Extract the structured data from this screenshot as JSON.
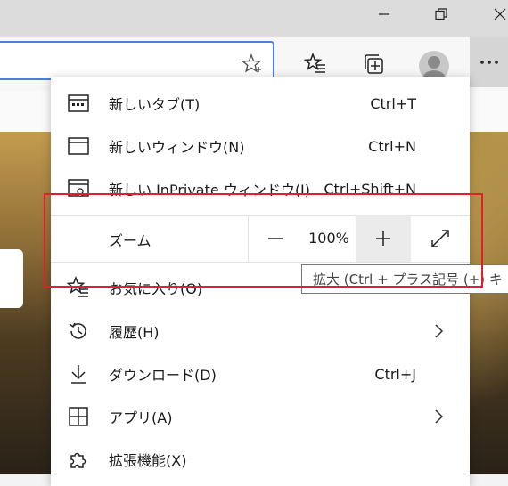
{
  "window": {
    "minimize_icon": "minimize-icon",
    "restore_icon": "restore-icon",
    "close_icon": "close-icon"
  },
  "toolbar": {
    "favorite_star_icon": "star-add-icon",
    "favorites_icon": "favorites-list-icon",
    "collections_icon": "collections-icon",
    "profile_icon": "profile-avatar-icon",
    "more_icon": "more-horizontal-icon"
  },
  "menu": {
    "items_top": [
      {
        "label": "新しいタブ(T)",
        "shortcut": "Ctrl+T",
        "icon": "new-tab-icon"
      },
      {
        "label": "新しいウィンドウ(N)",
        "shortcut": "Ctrl+N",
        "icon": "new-window-icon"
      },
      {
        "label": "新しい InPrivate ウィンドウ(I)",
        "shortcut": "Ctrl+Shift+N",
        "icon": "inprivate-window-icon"
      }
    ],
    "zoom": {
      "label": "ズーム",
      "value": "100%",
      "minus_icon": "zoom-out-icon",
      "plus_icon": "zoom-in-icon",
      "fullscreen_icon": "fullscreen-icon"
    },
    "items_bottom": [
      {
        "label": "お気に入り(O)",
        "shortcut": "",
        "icon": "favorites-icon"
      },
      {
        "label": "履歴(H)",
        "shortcut": "",
        "icon": "history-icon"
      },
      {
        "label": "ダウンロード(D)",
        "shortcut": "Ctrl+J",
        "icon": "download-icon"
      },
      {
        "label": "アプリ(A)",
        "shortcut": "",
        "icon": "apps-icon"
      },
      {
        "label": "拡張機能(X)",
        "shortcut": "",
        "icon": "extensions-icon"
      }
    ]
  },
  "tooltip": {
    "text": "拡大 (Ctrl + プラス記号 (+) キ"
  },
  "colors": {
    "highlight_box": "#e0202a",
    "address_focus": "#4a80d8"
  }
}
